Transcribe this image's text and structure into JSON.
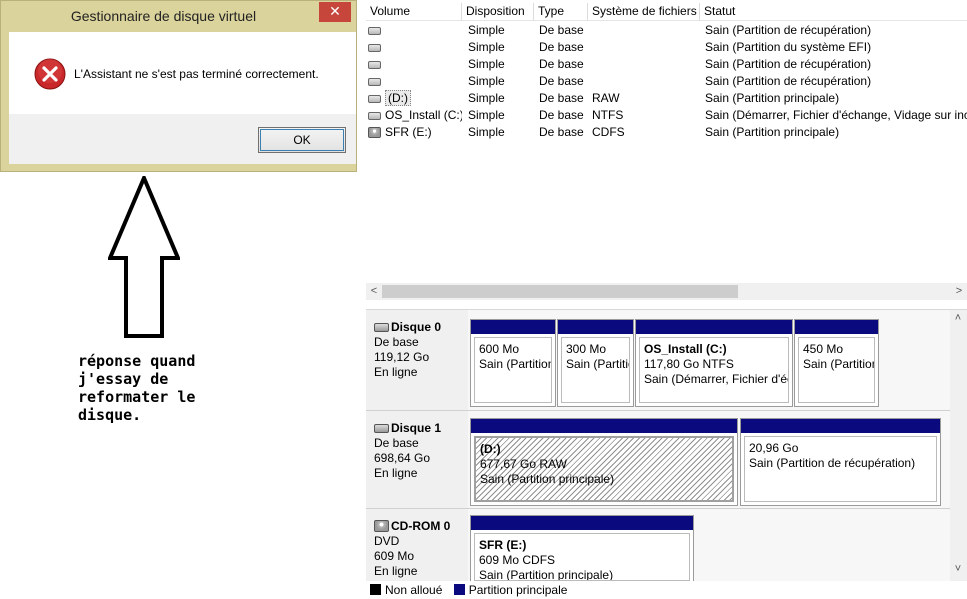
{
  "dialog": {
    "title": "Gestionnaire de disque virtuel",
    "close_glyph": "✕",
    "message": "L'Assistant ne s'est pas terminé correctement.",
    "ok_label": "OK"
  },
  "annotation": "réponse quand\nj'essay de\nreformater le\ndisque.",
  "volume_list": {
    "columns": [
      "Volume",
      "Disposition",
      "Type",
      "Système de fichiers",
      "Statut"
    ],
    "rows": [
      {
        "volume": "",
        "disposition": "Simple",
        "type": "De base",
        "fs": "",
        "status": "Sain (Partition de récupération)"
      },
      {
        "volume": "",
        "disposition": "Simple",
        "type": "De base",
        "fs": "",
        "status": "Sain (Partition du système EFI)"
      },
      {
        "volume": "",
        "disposition": "Simple",
        "type": "De base",
        "fs": "",
        "status": "Sain (Partition de récupération)"
      },
      {
        "volume": "",
        "disposition": "Simple",
        "type": "De base",
        "fs": "",
        "status": "Sain (Partition de récupération)"
      },
      {
        "volume": "(D:)",
        "disposition": "Simple",
        "type": "De base",
        "fs": "RAW",
        "status": "Sain (Partition principale)"
      },
      {
        "volume": "OS_Install (C:)",
        "disposition": "Simple",
        "type": "De base",
        "fs": "NTFS",
        "status": "Sain (Démarrer, Fichier d'échange, Vidage sur incident"
      },
      {
        "volume": "SFR (E:)",
        "disposition": "Simple",
        "type": "De base",
        "fs": "CDFS",
        "status": "Sain (Partition principale)"
      }
    ],
    "scroll_left": "<",
    "scroll_right": ">"
  },
  "disks": [
    {
      "name": "Disque 0",
      "type": "De base",
      "size": "119,12 Go",
      "state": "En ligne",
      "partitions": [
        {
          "name": "",
          "size": "600 Mo",
          "status": "Sain (Partition de récupération)"
        },
        {
          "name": "",
          "size": "300 Mo",
          "status": "Sain (Partition du système EFI)"
        },
        {
          "name": "OS_Install  (C:)",
          "size": "117,80 Go NTFS",
          "status": "Sain (Démarrer, Fichier d'échange, Vidage sur incident)"
        },
        {
          "name": "",
          "size": "450 Mo",
          "status": "Sain (Partition de récupération)"
        }
      ]
    },
    {
      "name": "Disque 1",
      "type": "De base",
      "size": "698,64 Go",
      "state": "En ligne",
      "partitions": [
        {
          "name": "(D:)",
          "size": "677,67 Go RAW",
          "status": "Sain (Partition principale)"
        },
        {
          "name": "",
          "size": "20,96 Go",
          "status": "Sain (Partition de récupération)"
        }
      ]
    },
    {
      "name": "CD-ROM 0",
      "type": "DVD",
      "size": "609 Mo",
      "state": "En ligne",
      "partitions": [
        {
          "name": "SFR  (E:)",
          "size": "609 Mo CDFS",
          "status": "Sain (Partition principale)"
        }
      ]
    }
  ],
  "scroll_up": "˄",
  "scroll_down": "˅",
  "legend": {
    "unallocated": "Non alloué",
    "primary": "Partition principale",
    "unallocated_color": "#000000",
    "primary_color": "#0a0a7e"
  },
  "colors": {
    "dialog_frame": "#dbd39c",
    "close_button": "#c7463b",
    "partition_bar": "#0a0a7e"
  }
}
